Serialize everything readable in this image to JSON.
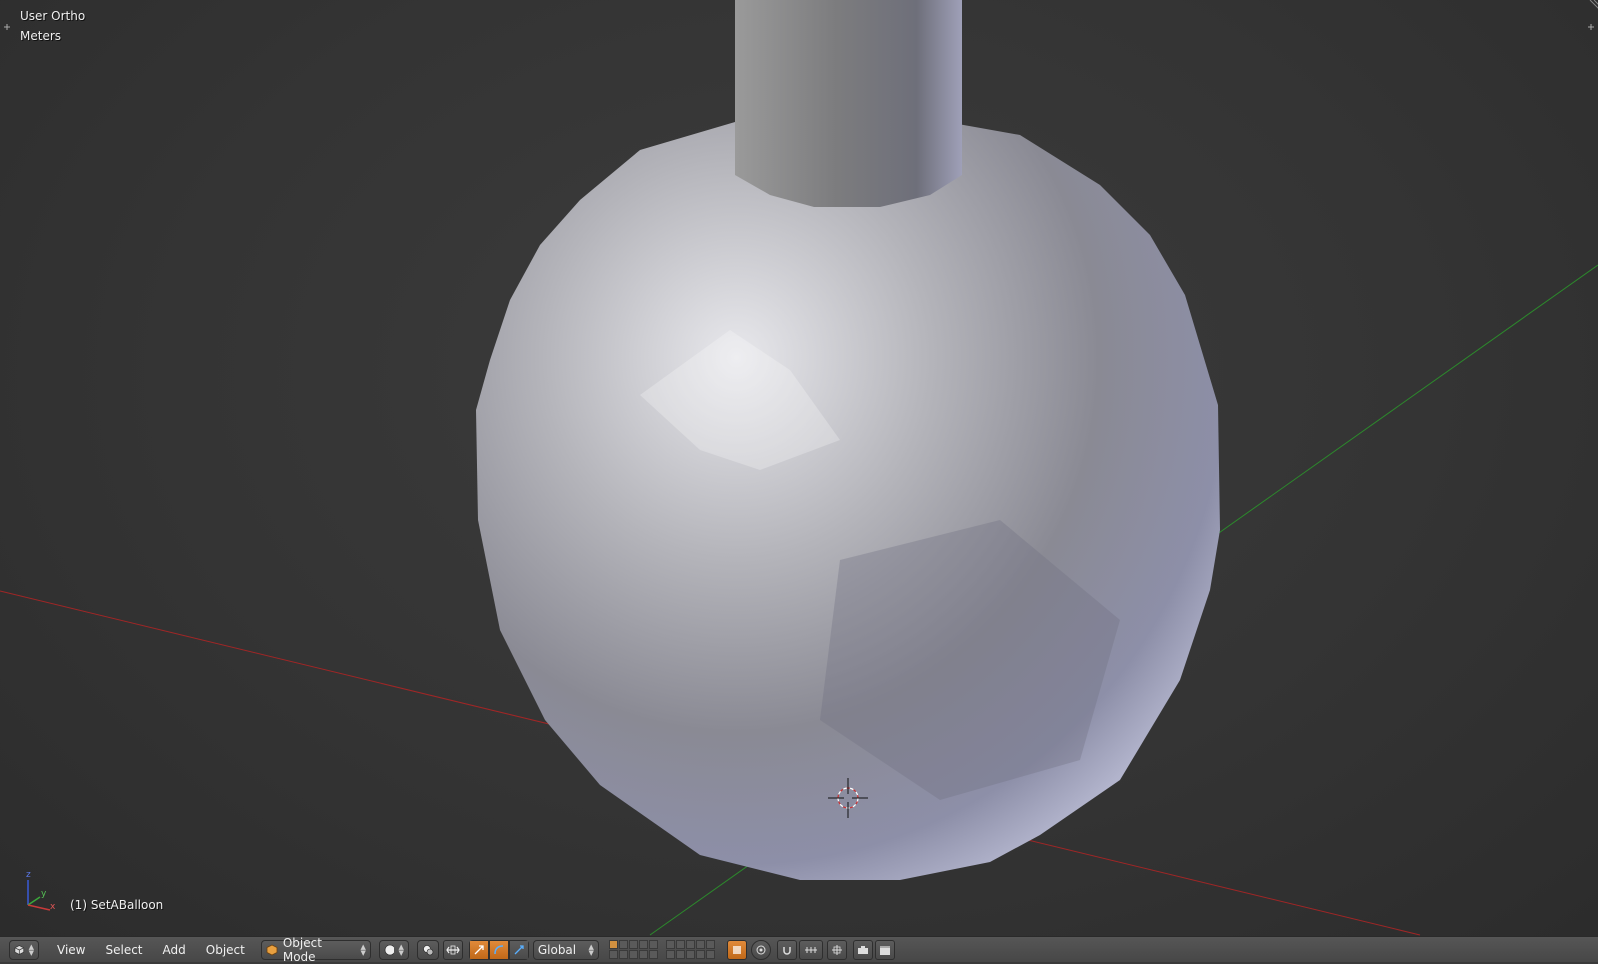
{
  "viewport": {
    "view_name": "User Ortho",
    "units": "Meters",
    "active_object": "(1) SetABalloon",
    "axis_gizmo": {
      "labels": [
        "z",
        "y",
        "x"
      ]
    },
    "icons": [
      "3d-cursor-icon",
      "axis-gizmo-icon"
    ]
  },
  "header": {
    "editor_type_icon": "cube-icon",
    "menus": [
      "View",
      "Select",
      "Add",
      "Object"
    ],
    "mode_dropdown": "Object Mode",
    "mode_icon": "object-cube-icon",
    "shading_icon": "solid-sphere-icon",
    "pivot_icon": "pivot-point-icon",
    "transform_orientation": "Global",
    "colors": {
      "active_tool": "#d07a28",
      "header_bg": "#4f4f4f"
    }
  }
}
